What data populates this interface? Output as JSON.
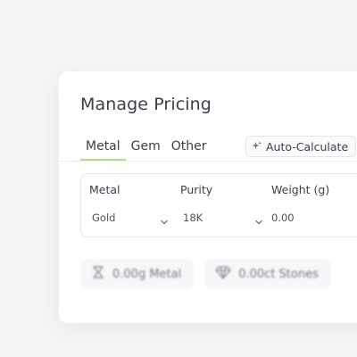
{
  "panel": {
    "title": "Manage Pricing"
  },
  "tabs": [
    {
      "label": "Metal",
      "active": true
    },
    {
      "label": "Gem",
      "active": false
    },
    {
      "label": "Other",
      "active": false
    }
  ],
  "auto_calculate": {
    "label": "Auto-Calculate",
    "icon": "sparkle-icon"
  },
  "table": {
    "headers": [
      "Metal",
      "Purity",
      "Weight (g)"
    ],
    "row": {
      "metal": "Gold",
      "purity": "18K",
      "weight": "0.00"
    }
  },
  "stats": [
    {
      "icon": "hourglass-icon",
      "label": "0.00g Metal"
    },
    {
      "icon": "diamond-icon",
      "label": "0.00ct Stones"
    }
  ],
  "colors": {
    "accent_underline": "#b9d98b",
    "background": "#f4f4f5",
    "card": "#ffffff"
  }
}
